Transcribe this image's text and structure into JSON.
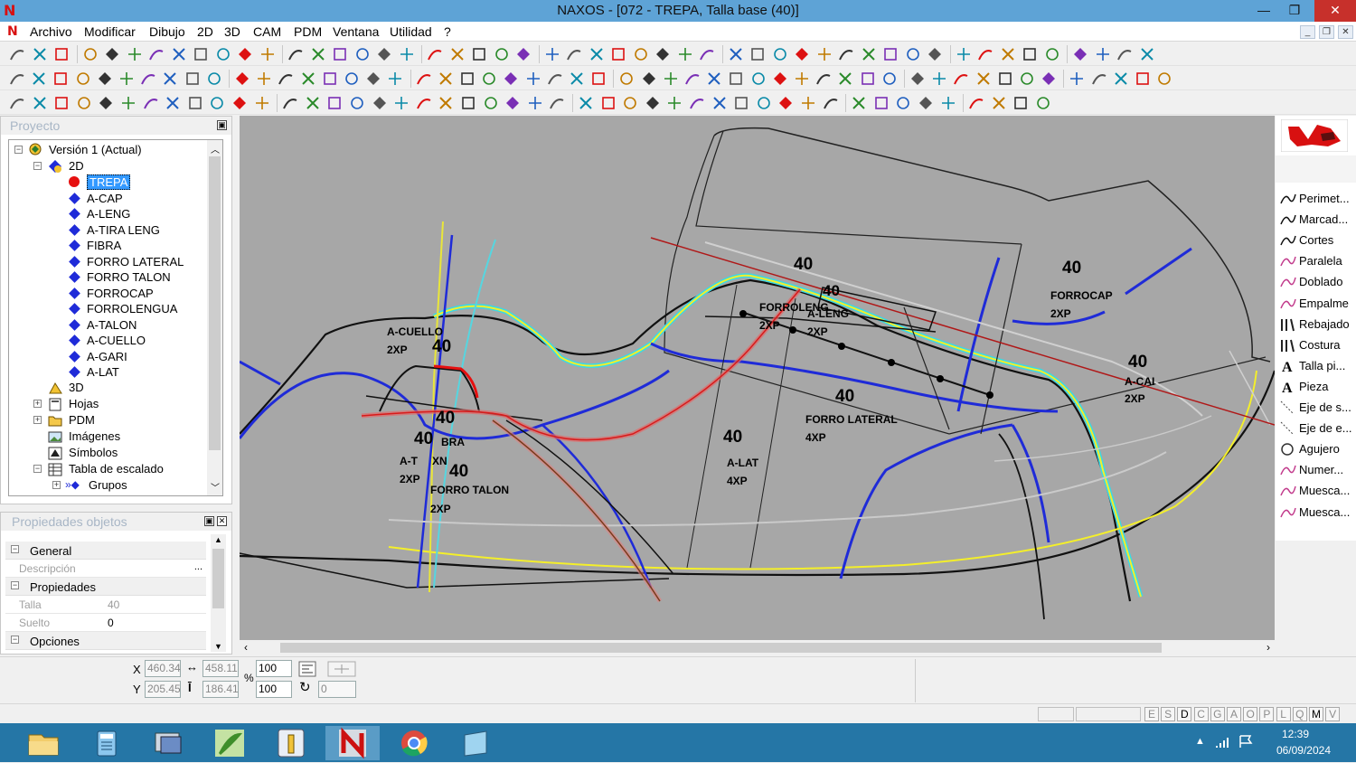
{
  "window": {
    "title": "NAXOS - [072 - TREPA, Talla base (40)]",
    "minimize": "—",
    "maximize": "❐",
    "close": "✕"
  },
  "menu": {
    "logo": "N",
    "items": [
      "Archivo",
      "Modificar",
      "Dibujo",
      "2D",
      "3D",
      "CAM",
      "PDM",
      "Ventana",
      "Utilidad",
      "?"
    ],
    "mdi_minimize": "_",
    "mdi_restore": "❐",
    "mdi_close": "✕"
  },
  "project": {
    "title": "Proyecto",
    "root": "Versión 1 (Actual)",
    "node_2d": "2D",
    "pieces": [
      "TREPA",
      "A-CAP",
      "A-LENG",
      "A-TIRA LENG",
      "FIBRA",
      "FORRO LATERAL",
      "FORRO TALON",
      "FORROCAP",
      "FORROLENGUA",
      "A-TALON",
      "A-CUELLO",
      "A-GARI",
      "A-LAT"
    ],
    "selected_piece": "TREPA",
    "other_nodes": [
      "3D",
      "Hojas",
      "PDM",
      "Imágenes",
      "Símbolos",
      "Tabla de escalado",
      "Grupos"
    ]
  },
  "properties": {
    "title": "Propiedades objetos",
    "sections": {
      "general": "General",
      "propiedades": "Propiedades",
      "opciones": "Opciones"
    },
    "descripcion_key": "Descripción",
    "descripcion_value": "",
    "descripcion_button": "...",
    "talla_key": "Talla",
    "talla_value": "40",
    "suelto_key": "Suelto",
    "suelto_value": "0"
  },
  "canvas_labels": {
    "size_40": "40",
    "a_cuello": "A-CUELLO",
    "two_xp": "2XP",
    "four_xp": "4XP",
    "forrolengua_partial": "FORROLENG",
    "a_leng": "A-LENG",
    "forrocap": "FORROCAP",
    "a_cap_partial": "A-CAI",
    "forro_lateral": "FORRO LATERAL",
    "a_lat": "A-LAT",
    "fibra_partial": "BRA",
    "a_talon_partial": "A-T",
    "talon_tail": "XN",
    "forro_talon": "FORRO TALON"
  },
  "tools": {
    "items": [
      "Perimet...",
      "Marcad...",
      "Cortes",
      "Paralela",
      "Doblado",
      "Empalme",
      "Rebajado",
      "Costura",
      "Talla pi...",
      "Pieza",
      "Eje de s...",
      "Eje de e...",
      "Agujero",
      "Numer...",
      "Muesca...",
      "Muesca..."
    ]
  },
  "coords": {
    "x_label": "X",
    "y_label": "Y",
    "x": "460.34",
    "y": "205.45",
    "w": "458.11",
    "h": "186.41",
    "scale_x": "100",
    "scale_y": "100",
    "percent": "%",
    "rotation": "0"
  },
  "status": {
    "keys": [
      "E",
      "S",
      "D",
      "C",
      "G",
      "A",
      "O",
      "P",
      "L",
      "Q",
      "M",
      "V"
    ],
    "active_keys": [
      "D",
      "M"
    ]
  },
  "taskbar": {
    "time": "12:39",
    "date": "06/09/2024"
  },
  "colors": {
    "titlebar": "#5ea3d6",
    "canvas": "#a7a7a7",
    "taskbar": "#2576a6",
    "piece_blue": "#1f2bd8",
    "selected_red": "#e61010"
  }
}
